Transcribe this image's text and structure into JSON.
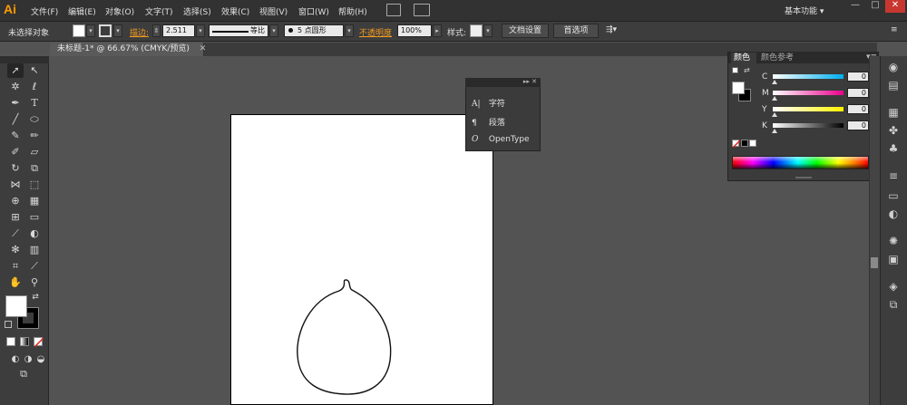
{
  "app": {
    "logo": "Ai",
    "workspace": "基本功能 ▾",
    "window_buttons": [
      "—",
      "□",
      "✕"
    ]
  },
  "menu": [
    "文件(F)",
    "编辑(E)",
    "对象(O)",
    "文字(T)",
    "选择(S)",
    "效果(C)",
    "视图(V)",
    "窗口(W)",
    "帮助(H)"
  ],
  "control": {
    "selection_status": "未选择对象",
    "stroke_label": "描边:",
    "stroke_weight": "2.511",
    "stroke_profile": "等比",
    "brush": "5 点圆形",
    "opacity_label": "不透明度",
    "opacity_value": "100%",
    "style_label": "样式:",
    "doc_setup": "文档设置",
    "preferences": "首选项"
  },
  "document_tab": {
    "label": "未标题-1* @ 66.67% (CMYK/预览)",
    "close": "✕"
  },
  "type_panel": {
    "header": "▸▸ ✕",
    "items": [
      {
        "icon": "A|",
        "label": "字符"
      },
      {
        "icon": "¶",
        "label": "段落"
      },
      {
        "icon": "O",
        "label": "OpenType"
      }
    ]
  },
  "color_panel": {
    "tab_color": "颜色",
    "tab_guide": "颜色参考",
    "channels": [
      {
        "letter": "C",
        "value": "0",
        "colors": [
          "#ffffff",
          "#00aeef"
        ]
      },
      {
        "letter": "M",
        "value": "0",
        "colors": [
          "#ffffff",
          "#ec008c"
        ]
      },
      {
        "letter": "Y",
        "value": "0",
        "colors": [
          "#ffffff",
          "#fff200"
        ]
      },
      {
        "letter": "K",
        "value": "0",
        "colors": [
          "#ffffff",
          "#000000"
        ]
      }
    ],
    "pct": "%"
  },
  "colors": {
    "ui_dark": "#323232",
    "ui_mid": "#3d3d3d",
    "canvas": "#535353",
    "accent_orange": "#f29b21",
    "close_red": "#c7372f"
  },
  "tools": [
    "selection-icon",
    "direct-selection-icon",
    "magic-wand-icon",
    "lasso-icon",
    "pen-icon",
    "type-icon",
    "line-icon",
    "ellipse-icon",
    "paintbrush-icon",
    "pencil-icon",
    "blob-brush-icon",
    "eraser-icon",
    "rotate-icon",
    "scale-icon",
    "width-icon",
    "free-transform-icon",
    "shape-builder-icon",
    "perspective-grid-icon",
    "mesh-icon",
    "gradient-icon",
    "eyedropper-icon",
    "blend-icon",
    "symbol-sprayer-icon",
    "column-graph-icon",
    "artboard-icon",
    "slice-icon",
    "hand-icon",
    "zoom-icon"
  ]
}
